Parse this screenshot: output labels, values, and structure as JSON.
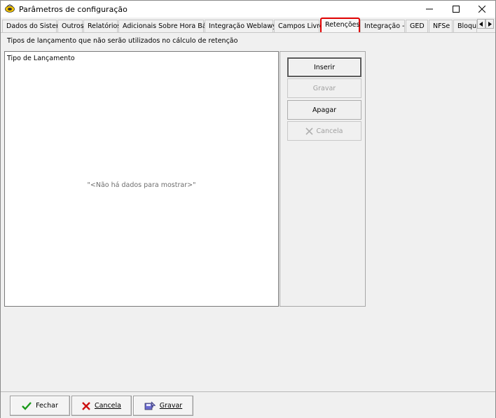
{
  "window": {
    "title": "Parâmetros de configuração"
  },
  "tabs": [
    {
      "label": "Dados do Sistema"
    },
    {
      "label": "Outros"
    },
    {
      "label": "Relatórios"
    },
    {
      "label": "Adicionais Sobre Hora Básica"
    },
    {
      "label": "Integração Weblawyer"
    },
    {
      "label": "Campos Livres"
    },
    {
      "label": "Retenções",
      "active": true
    },
    {
      "label": "Integração - TJ"
    },
    {
      "label": "GED"
    },
    {
      "label": "NFSe"
    },
    {
      "label": "Bloquei"
    }
  ],
  "panel": {
    "description": "Tipos de lançamento que não serão utilizados no cálculo de retenção",
    "grid_header": "Tipo de Lançamento",
    "empty_message": "\"<Não há dados para mostrar>\""
  },
  "actions": {
    "insert": "Inserir",
    "save": "Gravar",
    "delete": "Apagar",
    "cancel": "Cancela"
  },
  "footer": {
    "close": "Fechar",
    "cancel": "Cancela",
    "save": "Gravar"
  },
  "colors": {
    "active_tab_outline": "#e00000",
    "confirm_icon": "#1a9a1a",
    "cancel_icon": "#cc1111"
  }
}
